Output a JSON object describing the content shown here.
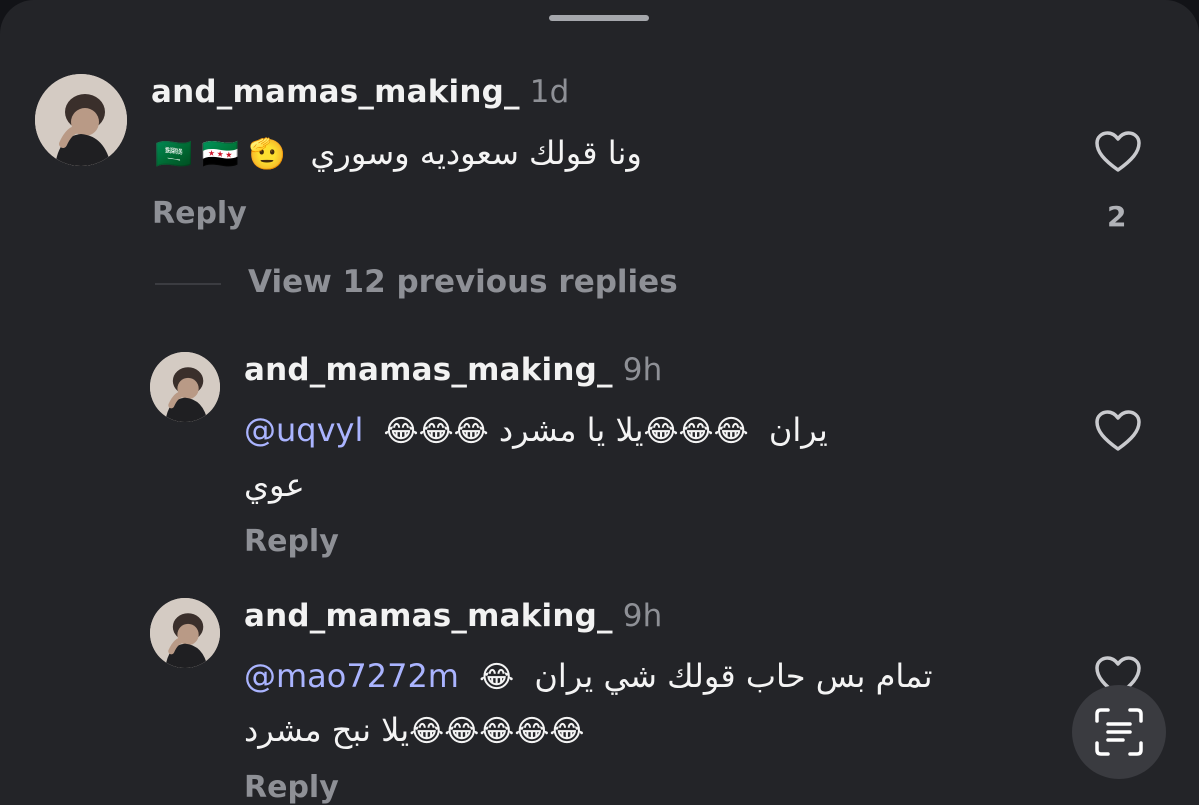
{
  "comments": [
    {
      "username": "and_mamas_making_",
      "time": "1d",
      "text": "ونا قولك سعوديه وسوري",
      "emojis": "🇸🇦 🇸🇾 🫡",
      "reply_label": "Reply",
      "likes": "2"
    }
  ],
  "view_replies_label": "View 12 previous replies",
  "replies": [
    {
      "username": "and_mamas_making_",
      "time": "9h",
      "mention": "@uqvyl",
      "line1_emojis_a": "😂😂😂",
      "line1_text_a": "يلا يا مشرد",
      "line1_emojis_b": "😂😂😂",
      "line1_text_b": "يران",
      "line2_text": "عوي",
      "reply_label": "Reply"
    },
    {
      "username": "and_mamas_making_",
      "time": "9h",
      "mention": "@mao7272m",
      "line1_emojis": "😂",
      "line1_text": "تمام بس حاب قولك شي يران",
      "line2_emojis": "😂😂😂😂😂",
      "line2_text": "يلا نبح مشرد",
      "reply_label": "Reply"
    }
  ],
  "fab_icon": "scan-text-icon",
  "colors": {
    "background": "#232428",
    "mention": "#aab4ff",
    "muted": "#8e9096"
  }
}
